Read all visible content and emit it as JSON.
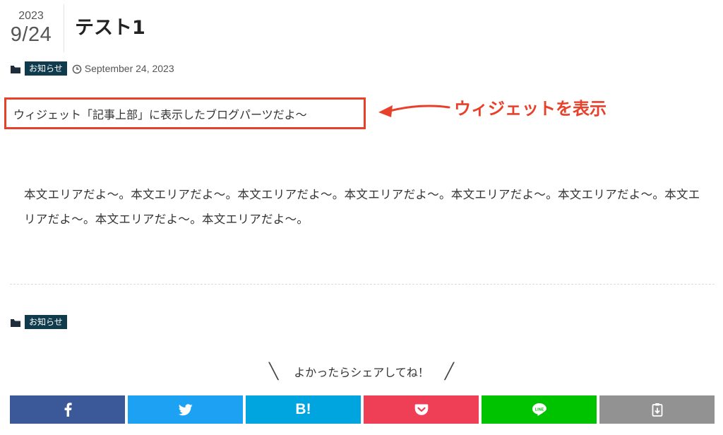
{
  "post": {
    "year": "2023",
    "month_day": "9/24",
    "title": "テスト1",
    "category": "お知らせ",
    "date": "September 24, 2023"
  },
  "widget": {
    "text": "ウィジェット「記事上部」に表示したブログパーツだよ〜"
  },
  "annotation": {
    "label": "ウィジェットを表示",
    "color": "#e8412b"
  },
  "content": {
    "body": "本文エリアだよ〜。本文エリアだよ〜。本文エリアだよ〜。本文エリアだよ〜。本文エリアだよ〜。本文エリアだよ〜。本文エリアだよ〜。本文エリアだよ〜。本文エリアだよ〜。"
  },
  "footer_meta": {
    "category": "お知らせ"
  },
  "share": {
    "heading": "よかったらシェアしてね！",
    "buttons": [
      {
        "icon": "facebook-icon",
        "color": "#3b5998"
      },
      {
        "icon": "twitter-icon",
        "color": "#1da1f2"
      },
      {
        "icon": "hatena-bookmark-icon",
        "label": "B!",
        "color": "#00a4de"
      },
      {
        "icon": "pocket-icon",
        "color": "#ef3f56"
      },
      {
        "icon": "line-icon",
        "label": "LINE",
        "color": "#00c300"
      },
      {
        "icon": "clipboard-copy-icon",
        "color": "#929292"
      }
    ]
  }
}
